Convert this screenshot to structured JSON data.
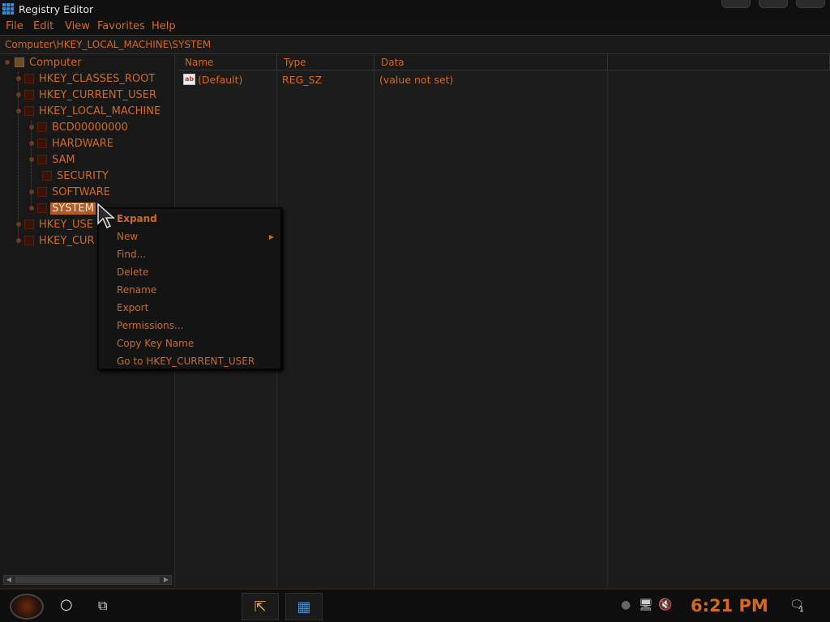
{
  "window": {
    "title": "Registry Editor"
  },
  "menu": [
    "File",
    "Edit",
    "View",
    "Favorites",
    "Help"
  ],
  "address": "Computer\\HKEY_LOCAL_MACHINE\\SYSTEM",
  "tree": {
    "root": "Computer",
    "hives": [
      "HKEY_CLASSES_ROOT",
      "HKEY_CURRENT_USER",
      "HKEY_LOCAL_MACHINE"
    ],
    "hklm_children": [
      "BCD00000000",
      "HARDWARE",
      "SAM",
      "SECURITY",
      "SOFTWARE",
      "SYSTEM"
    ],
    "trailing": [
      "HKEY_USE",
      "HKEY_CUR"
    ],
    "selected": "SYSTEM"
  },
  "columns": [
    "Name",
    "Type",
    "Data"
  ],
  "rows": [
    {
      "name": "(Default)",
      "type": "REG_SZ",
      "data": "(value not set)",
      "icon": "string-value-icon"
    }
  ],
  "context_menu": [
    "Expand",
    "New",
    "Find...",
    "Delete",
    "Rename",
    "Export",
    "Permissions...",
    "Copy Key Name",
    "Go to HKEY_CURRENT_USER"
  ],
  "taskbar": {
    "clock": "6:21 PM",
    "notifications": "1"
  },
  "colors": {
    "accent": "#d2691e",
    "selection": "#b35a24",
    "background": "#1c1c1c"
  }
}
